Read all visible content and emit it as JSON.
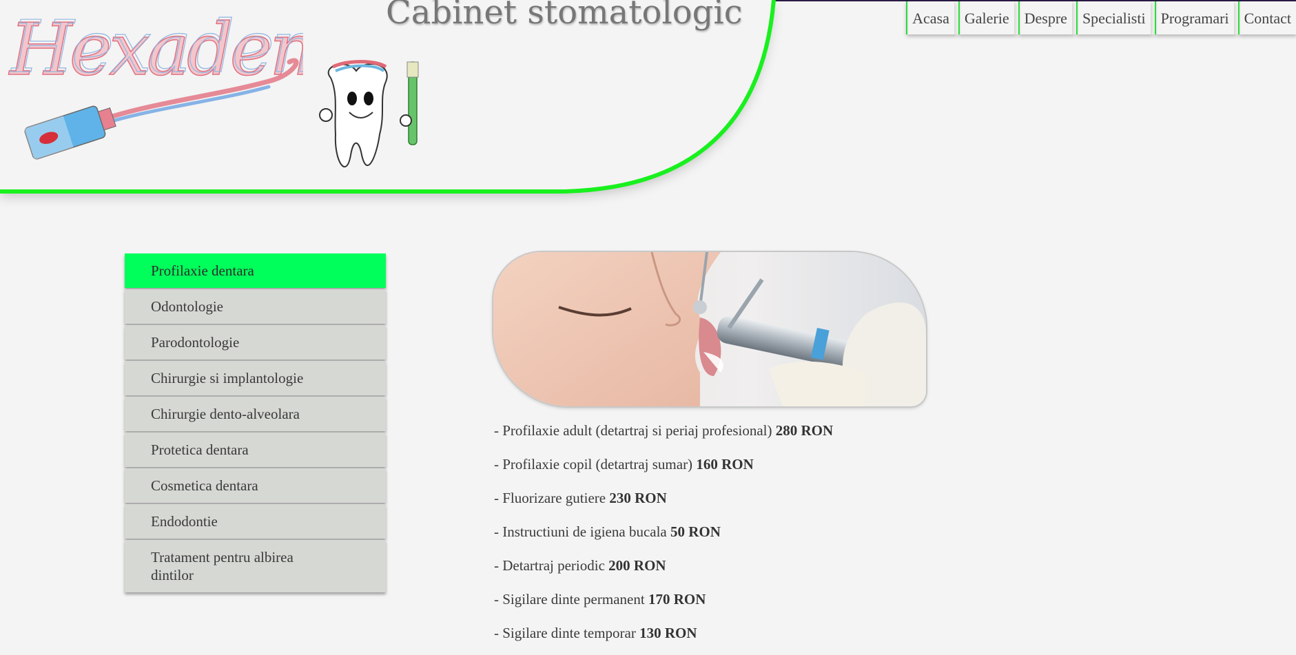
{
  "header": {
    "site_title": "Cabinet stomatologic",
    "logo_text": "Hexadent",
    "accent_color": "#00ff5a",
    "curve_color": "#19f01e"
  },
  "topnav": {
    "items": [
      {
        "label": "Acasa"
      },
      {
        "label": "Galerie"
      },
      {
        "label": "Despre"
      },
      {
        "label": "Specialisti"
      },
      {
        "label": "Programari"
      },
      {
        "label": "Contact"
      }
    ]
  },
  "sidebar": {
    "items": [
      {
        "label": "Profilaxie dentara",
        "active": true
      },
      {
        "label": "Odontologie"
      },
      {
        "label": "Parodontologie"
      },
      {
        "label": "Chirurgie si implantologie"
      },
      {
        "label": "Chirurgie dento-alveolara"
      },
      {
        "label": "Protetica dentara"
      },
      {
        "label": "Cosmetica dentara"
      },
      {
        "label": "Endodontie"
      },
      {
        "label": "Tratament pentru albirea dintilor"
      }
    ]
  },
  "main": {
    "prices": [
      {
        "text": "- Profilaxie adult (detartraj si periaj profesional) ",
        "price": "280 RON"
      },
      {
        "text": "- Profilaxie copil (detartraj sumar) ",
        "price": "160 RON"
      },
      {
        "text": "- Fluorizare gutiere ",
        "price": "230 RON"
      },
      {
        "text": "- Instructiuni de igiena bucala ",
        "price": "50 RON"
      },
      {
        "text": "- Detartraj periodic ",
        "price": "200 RON"
      },
      {
        "text": "- Sigilare dinte permanent ",
        "price": "170 RON"
      },
      {
        "text": "- Sigilare dinte temporar ",
        "price": "130 RON"
      }
    ]
  }
}
